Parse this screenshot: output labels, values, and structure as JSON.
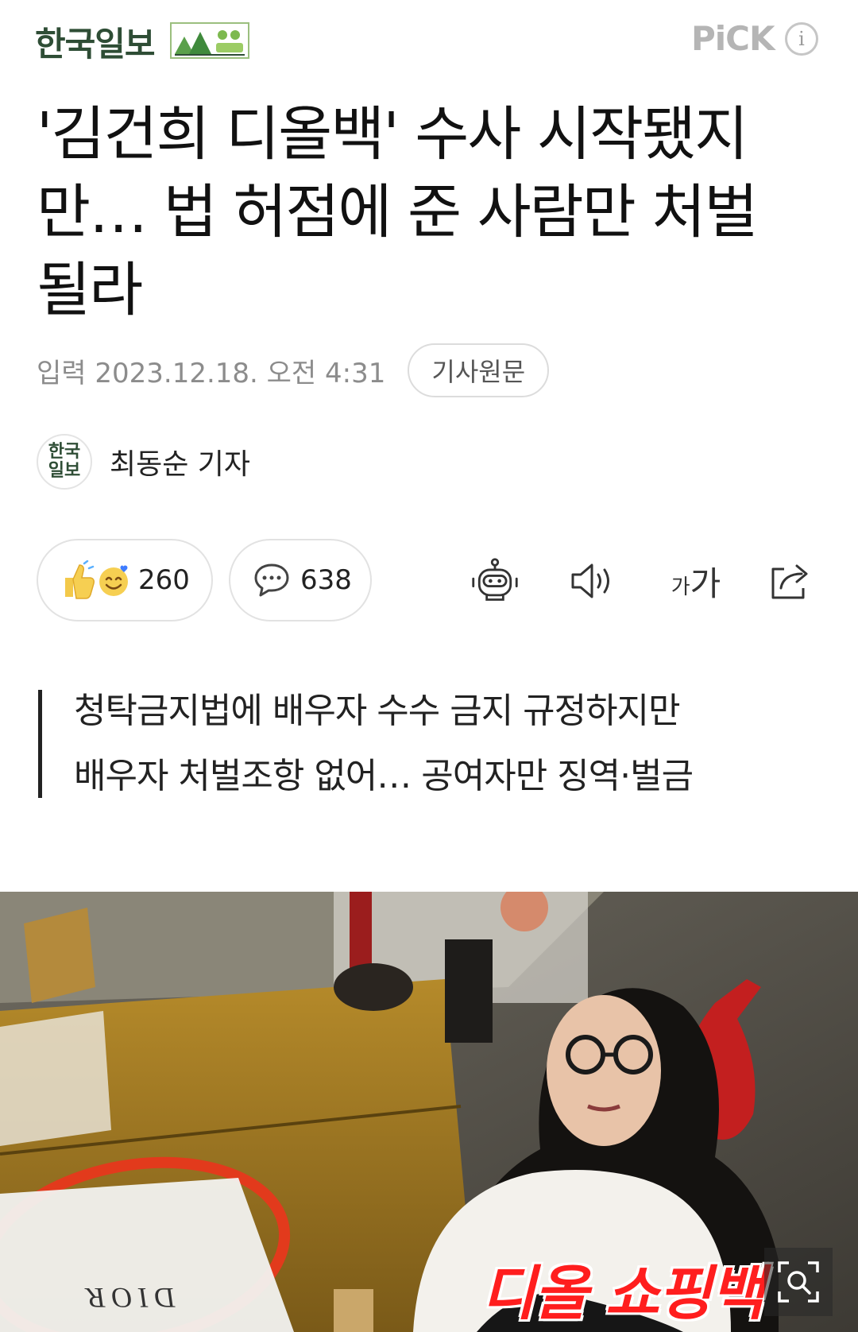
{
  "header": {
    "press_name": "한국일보",
    "pick_label": "PiCK",
    "info_label": "i"
  },
  "article": {
    "title_lines": [
      "'김건희 디올백' 수사 시작됐지",
      "만… 법 허점에 준 사람만 처벌",
      "될라"
    ],
    "date": "입력 2023.12.18. 오전 4:31",
    "source_button": "기사원문",
    "press_logo_lines": [
      "한국",
      "일보"
    ],
    "reporter": "최동순 기자",
    "subtitle_lines": [
      "청탁금지법에 배우자 수수 금지 규정하지만",
      "배우자 처벌조항 없어… 공여자만 징역·벌금"
    ]
  },
  "actions": {
    "reaction_count": "260",
    "comment_count": "638",
    "font_size_label_small": "가",
    "font_size_label_large": "가"
  },
  "photo": {
    "overlay_caption": "디올 쇼핑백",
    "box_text": "DIOR"
  },
  "icons": [
    "thumbs-up-icon",
    "smile-icon",
    "comment-icon",
    "summary-bot-icon",
    "speaker-icon",
    "font-size-icon",
    "share-icon",
    "expand-icon"
  ]
}
